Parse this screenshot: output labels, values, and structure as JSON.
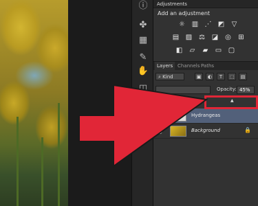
{
  "adjustments": {
    "panel_tab": "Adjustments",
    "title": "Add an adjustment",
    "row1_icons": [
      "brightness-icon",
      "levels-icon",
      "curves-icon",
      "exposure-icon"
    ],
    "row2_icons": [
      "vibrance-icon",
      "hue-saturation-icon",
      "color-balance-icon",
      "black-white-icon",
      "photo-filter-icon",
      "channel-mixer-icon",
      "color-lookup-icon"
    ],
    "row3_icons": [
      "invert-icon",
      "posterize-icon",
      "threshold-icon",
      "gradient-map-icon",
      "selective-color-icon"
    ],
    "row1_glyphs": [
      "☼",
      "▥",
      "⋰",
      "◩",
      "▽"
    ],
    "row2_glyphs": [
      "▤",
      "▨",
      "⚖",
      "◪",
      "◎",
      "⊞"
    ],
    "row3_glyphs": [
      "◧",
      "▱",
      "▰",
      "▭",
      "▢"
    ]
  },
  "layers_panel": {
    "tabs": [
      "Layers",
      "Channels",
      "Paths"
    ],
    "filter_kind": "Kind",
    "filter_icons": [
      "▣",
      "◐",
      "T",
      "⬚",
      "▤"
    ],
    "opacity_label": "Opacity:",
    "opacity_value": "45%",
    "layers": [
      {
        "name": "Hydrangeas",
        "selected": true,
        "visible": false,
        "locked": false
      },
      {
        "name": "Background",
        "selected": false,
        "visible": true,
        "locked": true
      }
    ]
  },
  "colors": {
    "annotation_red": "#e12637",
    "selected_layer": "#52607a",
    "panel_bg": "#323232"
  }
}
